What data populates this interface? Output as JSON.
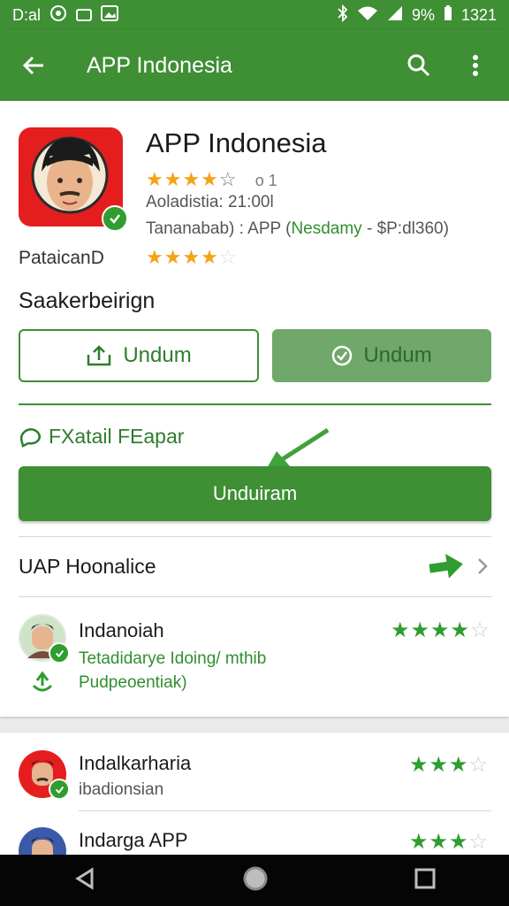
{
  "status_bar": {
    "left_text": "D:al",
    "battery": "9%",
    "time": "1321"
  },
  "app_bar": {
    "title": "APP Indonesia"
  },
  "app": {
    "title": "APP Indonesia",
    "rating_text": "o 1",
    "downloads": "Aoladistia: 21:00l",
    "publisher_line_prefix": "Tananabab) : APP (",
    "publisher_highlight": "Nesdamy",
    "publisher_line_suffix": " - $P:dl360)",
    "developer": "PataicanD"
  },
  "section_title": "Saakerbeirign",
  "buttons": {
    "outline_label": "Undum",
    "filled_label": "Undum",
    "primary_label": "Unduiram"
  },
  "feature_link": "FXatail FEapar",
  "list_row": {
    "label": "UAP Hoonalice"
  },
  "reviews": [
    {
      "name": "Indanoiah",
      "text_line1": "Tetadidarye Idoing/ mthib",
      "text_line2": "Pudpeoentiak)"
    }
  ],
  "suggestions": [
    {
      "name": "Indalkarharia",
      "sub": "ibadionsian"
    },
    {
      "name": "Indarga APP",
      "sub": ""
    }
  ],
  "colors": {
    "primary": "#3f8f35",
    "star": "#f3a316",
    "red_icon": "#e41e1e"
  }
}
